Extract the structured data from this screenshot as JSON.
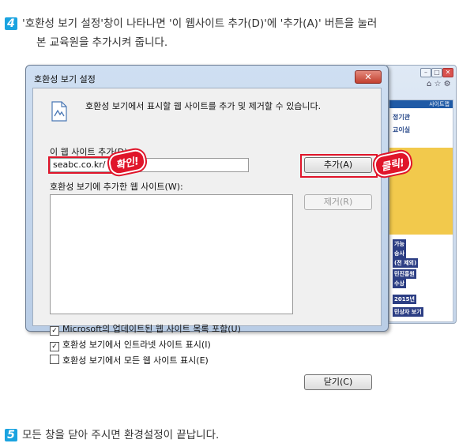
{
  "steps": [
    {
      "number": "4",
      "line1": "'호환성 보기 설정'창이 나타나면 '이 웹사이트 추가(D)'에 '추가(A)' 버튼을 눌러",
      "line2": "본 교육원을 추가시켜 줍니다."
    },
    {
      "number": "5",
      "line1": "모든 창을 닫아 주시면 환경설정이 끝납니다."
    }
  ],
  "background_window": {
    "tab_label": "사이트맵",
    "lines": [
      "정기관",
      "교이실"
    ],
    "strips": [
      "가능",
      "숭사",
      "(전 제외)",
      "민진흥원",
      "수상",
      "2015년",
      "민상자 보기"
    ]
  },
  "dialog": {
    "title": "호환성 보기 설정",
    "close_glyph": "✕",
    "intro": "호환성 보기에서 표시할 웹 사이트를 추가 및 제거할 수 있습니다.",
    "add_site_label": "이 웹 사이트 추가(D):",
    "add_site_value": "seabc.co.kr/",
    "add_button": "추가(A)",
    "list_label": "호환성 보기에 추가한 웹 사이트(W):",
    "remove_button": "제거(R)",
    "checkboxes": [
      {
        "label": "Microsoft의 업데이트된 웹 사이트 목록 포함(U)",
        "checked": true
      },
      {
        "label": "호환성 보기에서 인트라넷 사이트 표시(I)",
        "checked": true
      },
      {
        "label": "호환성 보기에서 모든 웹 사이트 표시(E)",
        "checked": false
      }
    ],
    "close_button": "닫기(C)"
  },
  "callouts": {
    "confirm": "확인!",
    "click": "클릭!"
  },
  "colors": {
    "highlight": "#e0152a",
    "step_badge": "#1aa3e0"
  }
}
